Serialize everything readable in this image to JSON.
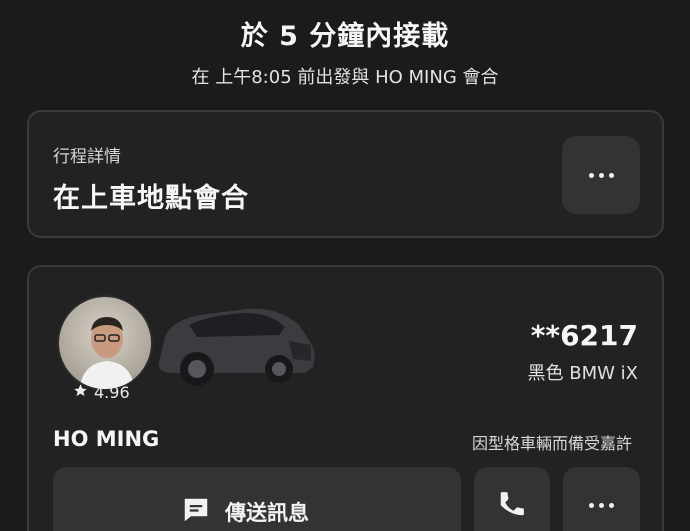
{
  "header": {
    "title": "於 5 分鐘內接載",
    "subtitle": "在 上午8:05 前出發與 HO MING 會合"
  },
  "trip": {
    "label": "行程詳情",
    "place": "在上車地點會合",
    "more_icon": "more-dots-icon"
  },
  "driver": {
    "rating": "4.96",
    "rating_icon": "star-icon",
    "plate": "**6217",
    "car_model": "黑色 BMW iX",
    "name": "HO MING",
    "compliment": "因型格車輛而備受嘉許",
    "car_color": "#3b3c40"
  },
  "actions": {
    "message_label": "傳送訊息",
    "message_icon": "message-icon",
    "call_icon": "phone-icon",
    "more_icon": "more-dots-icon"
  }
}
